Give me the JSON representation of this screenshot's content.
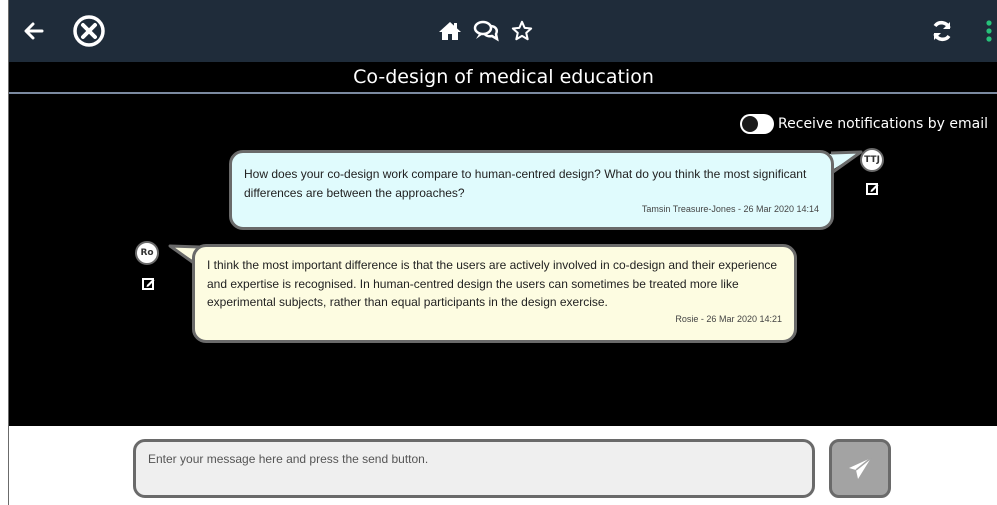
{
  "header": {
    "icons": [
      "back-arrow-icon",
      "close-circle-icon",
      "home-icon",
      "chat-icon",
      "star-icon",
      "refresh-icon",
      "more-icon"
    ]
  },
  "title": "Co-design of medical education",
  "notifications": {
    "label": "Receive notifications by email",
    "enabled": false
  },
  "messages": [
    {
      "author_initials": "TTJ",
      "text": "How does your co-design work compare to human-centred design? What do you think the most significant differences are between the approaches?",
      "meta": "Tamsin Treasure-Jones - 26 Mar 2020 14:14"
    },
    {
      "author_initials": "Ro",
      "text": "I think the most important difference is that the users are actively involved in co-design and their experience and expertise is recognised. In human-centred design the users can sometimes be treated more like experimental subjects, rather than equal participants in the design exercise.",
      "meta": "Rosie - 26 Mar 2020 14:21"
    }
  ],
  "composer": {
    "placeholder": "Enter your message here and press the send button."
  },
  "colors": {
    "topbar": "#1f2c3a",
    "chat_background": "#000000",
    "bubble_self": "#e0fbfd",
    "bubble_other": "#fdfce1",
    "accent_dots": "#27c27a"
  }
}
